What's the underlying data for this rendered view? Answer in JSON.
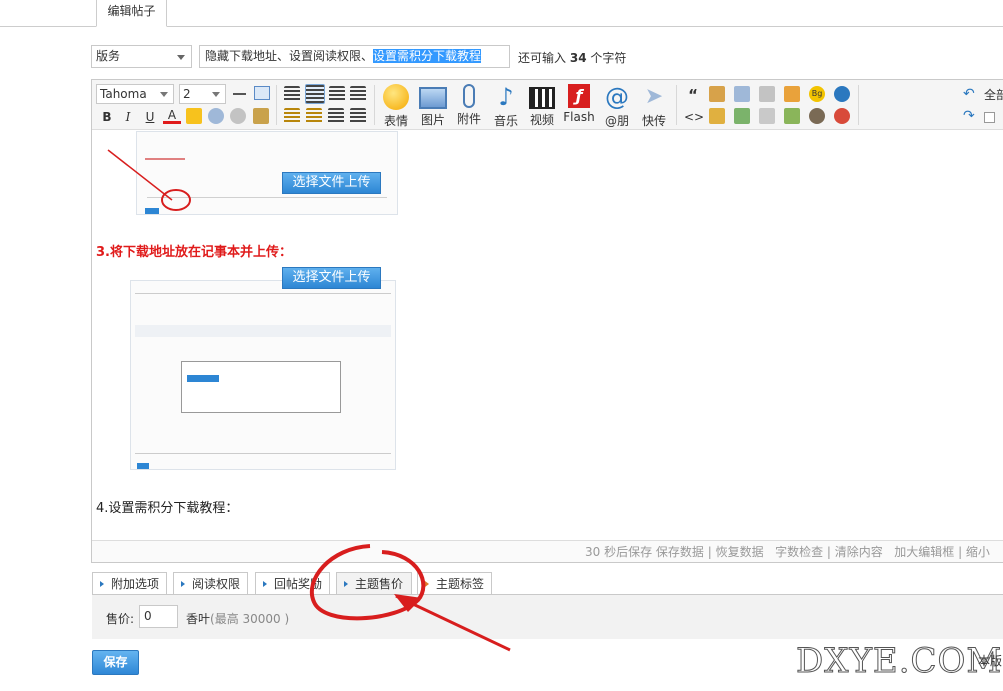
{
  "top_tab": {
    "label": "编辑帖子"
  },
  "post": {
    "category": "版务",
    "title_plain": "隐藏下载地址、设置阅读权限、",
    "title_selected": "设置需积分下载教程",
    "char_hint_prefix": "还可输入",
    "char_hint_count": "34",
    "char_hint_suffix": "个字符"
  },
  "toolbar": {
    "font_family": "Tahoma",
    "font_size": "2",
    "bold": "B",
    "italic": "I",
    "underline": "U",
    "font_color": "A",
    "buttons": [
      "表情",
      "图片",
      "附件",
      "音乐",
      "视频",
      "Flash",
      "@朋",
      "快传"
    ],
    "quote": "“",
    "code": "<>",
    "right_label": "全部"
  },
  "content": {
    "upload_button": "选择文件上传",
    "step3": "3.将下载地址放在记事本并上传：",
    "step4": "4.设置需积分下载教程："
  },
  "status": {
    "autosave": "30 秒后保存",
    "links": [
      "保存数据",
      "恢复数据",
      "字数检查",
      "清除内容",
      "加大编辑框",
      "缩小"
    ]
  },
  "options": {
    "tabs": [
      "附加选项",
      "阅读权限",
      "回帖奖励",
      "主题售价",
      "主题标签"
    ],
    "price_label": "售价:",
    "price_value": "0",
    "price_unit": "香叶",
    "price_max": "(最高 30000 )"
  },
  "footer": {
    "save_label": "保存",
    "tail_text": "本版"
  },
  "watermark": {
    "text": "DXYE.COM"
  }
}
